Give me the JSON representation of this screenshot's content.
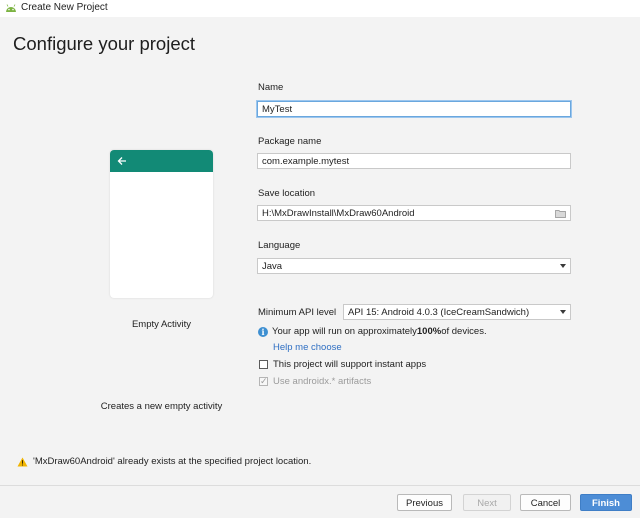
{
  "window": {
    "title": "Create New Project"
  },
  "header": {
    "title": "Configure your project"
  },
  "template": {
    "name": "Empty Activity",
    "description": "Creates a new empty activity"
  },
  "form": {
    "name_label": "Name",
    "name_value": "MyTest",
    "package_label": "Package name",
    "package_value": "com.example.mytest",
    "save_label": "Save location",
    "save_value": "H:\\MxDrawInstall\\MxDraw60Android",
    "language_label": "Language",
    "language_value": "Java",
    "min_api_label": "Minimum API level",
    "min_api_value": "API 15: Android 4.0.3 (IceCreamSandwich)",
    "info_prefix": "Your app will run on approximately ",
    "info_percent": "100%",
    "info_suffix": " of devices.",
    "help_link": "Help me choose",
    "instant_apps_label": "This project will support instant apps",
    "instant_apps_checked": false,
    "androidx_label": "Use androidx.* artifacts",
    "androidx_checked": true
  },
  "warning": {
    "text": "'MxDraw60Android' already exists at the specified project location."
  },
  "buttons": {
    "previous": "Previous",
    "next": "Next",
    "cancel": "Cancel",
    "finish": "Finish"
  },
  "colors": {
    "accent": "#4d8dd6",
    "appbar": "#128a76",
    "link": "#2f6fc3",
    "warning": "#f0b400"
  }
}
